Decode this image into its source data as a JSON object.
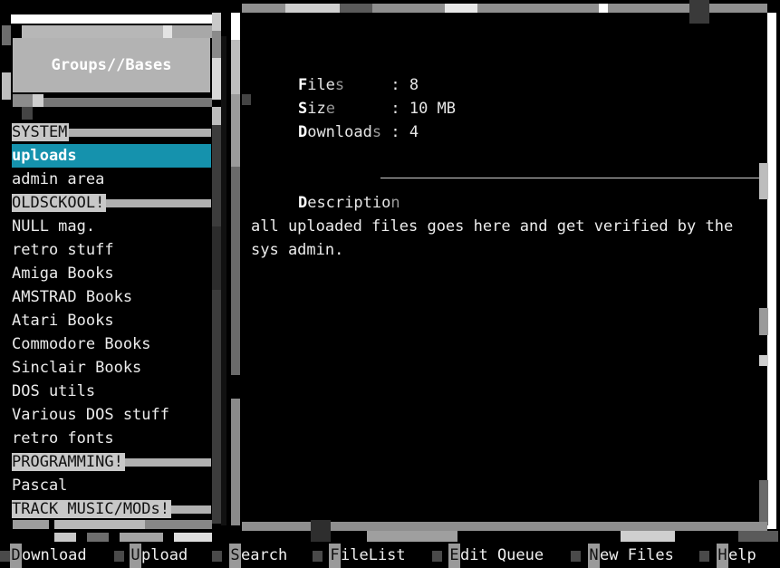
{
  "left_panel": {
    "header": "Groups//Bases",
    "groups": [
      {
        "label": "SYSTEM",
        "kind": "cat"
      },
      {
        "label": "uploads",
        "kind": "sel"
      },
      {
        "label": "admin area",
        "kind": "item"
      },
      {
        "label": "OLDSCKOOL!",
        "kind": "cat"
      },
      {
        "label": "NULL mag.",
        "kind": "item"
      },
      {
        "label": "retro stuff",
        "kind": "item"
      },
      {
        "label": "Amiga Books",
        "kind": "item"
      },
      {
        "label": "AMSTRAD Books",
        "kind": "item"
      },
      {
        "label": "Atari Books",
        "kind": "item"
      },
      {
        "label": "Commodore Books",
        "kind": "item"
      },
      {
        "label": "Sinclair Books",
        "kind": "item"
      },
      {
        "label": "DOS utils",
        "kind": "item"
      },
      {
        "label": "Various DOS stuff",
        "kind": "item"
      },
      {
        "label": "retro fonts",
        "kind": "item"
      },
      {
        "label": "PROGRAMMING!",
        "kind": "cat"
      },
      {
        "label": "Pascal",
        "kind": "item"
      },
      {
        "label": "TRACK MUSIC/MODs!",
        "kind": "cat"
      }
    ]
  },
  "details": {
    "files": {
      "hotkey": "F",
      "mid": "ile",
      "tail": "s",
      "pad": "     ",
      "value": ": 8"
    },
    "size": {
      "hotkey": "S",
      "mid": "iz",
      "tail": "e",
      "pad": "      ",
      "value": ": 10 MB"
    },
    "downloads": {
      "hotkey": "D",
      "mid": "ownload",
      "tail": "s",
      "pad": " ",
      "value": ": 4"
    },
    "description_header": {
      "hotkey": "D",
      "mid": "escriptio",
      "tail": "n"
    },
    "description_text": "all uploaded files goes here and get verified by the sys admin."
  },
  "commands": [
    {
      "key": "D",
      "label": "ownload"
    },
    {
      "key": "U",
      "label": "pload"
    },
    {
      "key": "S",
      "label": "earch"
    },
    {
      "key": "F",
      "label": "ileList"
    },
    {
      "key": "E",
      "label": "dit Queue"
    },
    {
      "key": "N",
      "label": "ew Files"
    },
    {
      "key": "H",
      "label": "elp"
    }
  ],
  "colors": {
    "selection": "#1592ad",
    "panel_gray": "#b3b3b3",
    "background": "#000000"
  }
}
